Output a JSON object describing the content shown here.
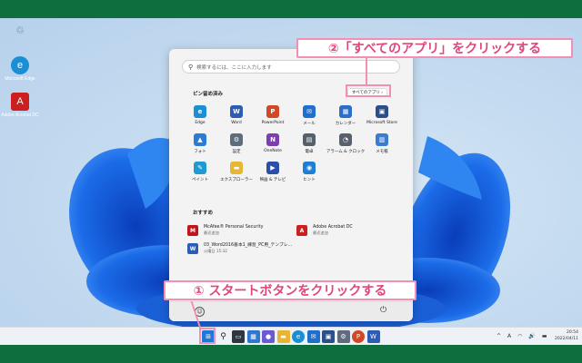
{
  "colors": {
    "frame": "#0f6e3d",
    "callout": "#e0457e",
    "callout_border": "#f28fb3",
    "bloom": "#1b5fd9"
  },
  "desktop_icons": [
    {
      "name": "recycle-bin",
      "label": "",
      "icon": "recycle-bin-icon"
    },
    {
      "name": "edge",
      "label": "Microsoft Edge",
      "icon": "edge-icon"
    },
    {
      "name": "acrobat",
      "label": "Adobe Acrobat DC",
      "icon": "acrobat-icon"
    }
  ],
  "start_menu": {
    "search_placeholder": "検索するには、ここに入力します",
    "pinned_title": "ピン留め済み",
    "all_apps_label": "すべてのアプリ  ›",
    "pinned": [
      {
        "label": "Edge",
        "color": "#1b8fd6",
        "glyph": "e"
      },
      {
        "label": "Word",
        "color": "#2b5cb6",
        "glyph": "W"
      },
      {
        "label": "PowerPoint",
        "color": "#d24726",
        "glyph": "P"
      },
      {
        "label": "メール",
        "color": "#1f6fd0",
        "glyph": "✉"
      },
      {
        "label": "カレンダー",
        "color": "#2a6fc9",
        "glyph": "▦"
      },
      {
        "label": "Microsoft Store",
        "color": "#2b4f8a",
        "glyph": "▣"
      },
      {
        "label": "フォト",
        "color": "#2c7bd6",
        "glyph": "▲"
      },
      {
        "label": "設定",
        "color": "#5e6c7d",
        "glyph": "⚙"
      },
      {
        "label": "OneNote",
        "color": "#7b3fb0",
        "glyph": "N"
      },
      {
        "label": "電卓",
        "color": "#55606b",
        "glyph": "▤"
      },
      {
        "label": "アラーム & クロック",
        "color": "#56616c",
        "glyph": "◔"
      },
      {
        "label": "メモ帳",
        "color": "#3b7bd1",
        "glyph": "▥"
      },
      {
        "label": "ペイント",
        "color": "#1f9bd0",
        "glyph": "✎"
      },
      {
        "label": "エクスプローラー",
        "color": "#e6b733",
        "glyph": "▬"
      },
      {
        "label": "映画 & テレビ",
        "color": "#2b4fa8",
        "glyph": "▶"
      },
      {
        "label": "ヒント",
        "color": "#1e7fd4",
        "glyph": "◉"
      }
    ],
    "recommended_title": "おすすめ",
    "recommended": [
      {
        "title": "McAfee® Personal Security",
        "sub": "最近追加",
        "color": "#c0151b",
        "glyph": "M"
      },
      {
        "title": "Adobe Acrobat DC",
        "sub": "最近追加",
        "color": "#cc1f1f",
        "glyph": "A"
      },
      {
        "title": "03_Word2016基本1_練習_PC用_テンプレ...",
        "sub": "火曜日 15:32",
        "color": "#2b5cb6",
        "glyph": "W"
      }
    ]
  },
  "taskbar": {
    "icons": [
      {
        "name": "start",
        "color": "#1c79d8",
        "glyph": "⊞"
      },
      {
        "name": "search",
        "color": "transparent",
        "glyph": "⚲"
      },
      {
        "name": "task-view",
        "color": "#2f3640",
        "glyph": "▭"
      },
      {
        "name": "widgets",
        "color": "#2e79cf",
        "glyph": "▦"
      },
      {
        "name": "chat",
        "color": "#6b5bd2",
        "glyph": "●"
      },
      {
        "name": "explorer",
        "color": "#e8b530",
        "glyph": "▬"
      },
      {
        "name": "edge",
        "color": "#1b8fd6",
        "glyph": "e"
      },
      {
        "name": "mail",
        "color": "#1f6fd0",
        "glyph": "✉"
      },
      {
        "name": "store",
        "color": "#2b4f8a",
        "glyph": "▣"
      },
      {
        "name": "settings",
        "color": "#5e6c7d",
        "glyph": "⚙"
      },
      {
        "name": "powerpoint",
        "color": "#d24726",
        "glyph": "P"
      },
      {
        "name": "word",
        "color": "#2b5cb6",
        "glyph": "W"
      }
    ],
    "tray": [
      "^",
      "A",
      "◠",
      "🔊",
      "▬"
    ],
    "time": "20:54",
    "date": "2022/04/11"
  },
  "callouts": {
    "all_apps": "②「すべてのアプリ」をクリックする",
    "start_button": "① スタートボタンをクリックする"
  }
}
